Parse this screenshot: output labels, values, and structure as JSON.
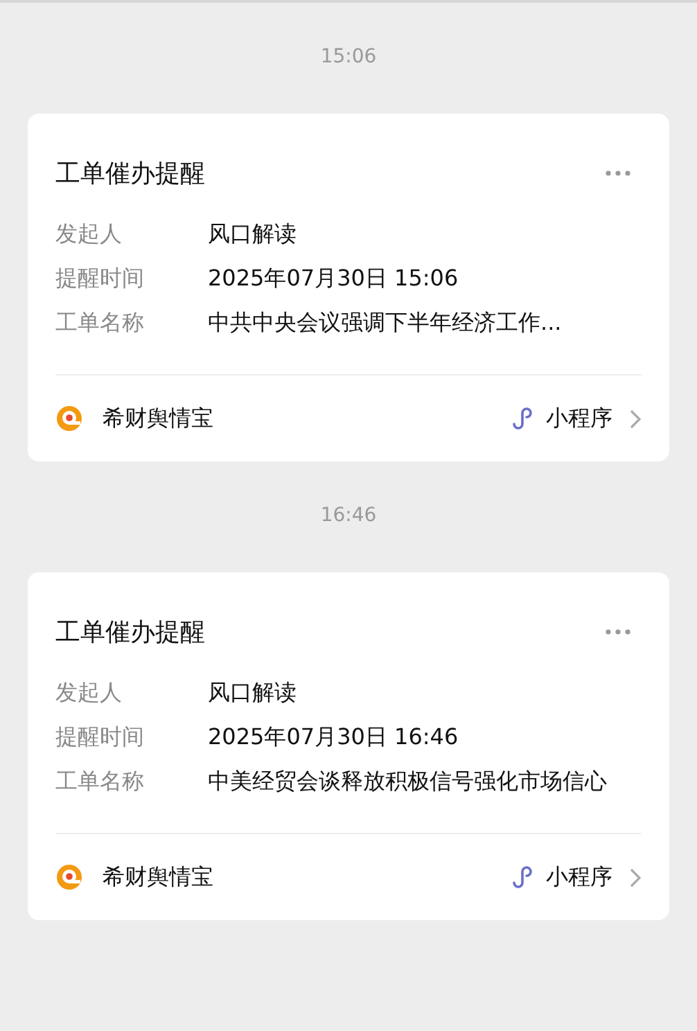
{
  "messages": [
    {
      "time": "15:06",
      "card": {
        "title": "工单催办提醒",
        "fields": [
          {
            "label": "发起人",
            "value": "风口解读"
          },
          {
            "label": "提醒时间",
            "value": "2025年07月30日 15:06"
          },
          {
            "label": "工单名称",
            "value": "中共中央会议强调下半年经济工作..."
          }
        ],
        "source": "希财舆情宝",
        "link": "小程序"
      }
    },
    {
      "time": "16:46",
      "card": {
        "title": "工单催办提醒",
        "fields": [
          {
            "label": "发起人",
            "value": "风口解读"
          },
          {
            "label": "提醒时间",
            "value": "2025年07月30日 16:46"
          },
          {
            "label": "工单名称",
            "value": "中美经贸会谈释放积极信号强化市场信心"
          }
        ],
        "source": "希财舆情宝",
        "link": "小程序"
      }
    }
  ]
}
